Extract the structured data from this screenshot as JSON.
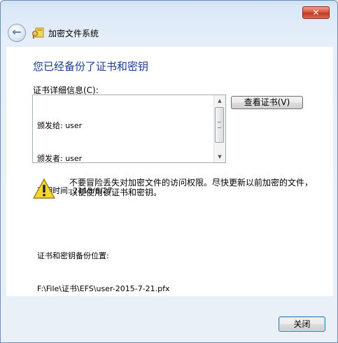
{
  "window": {
    "title": "加密文件系统"
  },
  "heading": "您已经备份了证书和密钥",
  "details": {
    "label": "证书详细信息(C):",
    "lines": [
      "颁发给: user",
      "颁发者: user",
      "过期时间: 2115/6/27",
      "",
      "证书和密钥备份位置:",
      "F:\\File\\证书\\EFS\\user-2015-7-21.pfx"
    ]
  },
  "buttons": {
    "view_cert": "查看证书(V)",
    "close": "关闭"
  },
  "warning": {
    "text": "不要冒险丢失对加密文件的访问权限。尽快更新以前加密的文件，以便使用该证书和密钥。"
  }
}
